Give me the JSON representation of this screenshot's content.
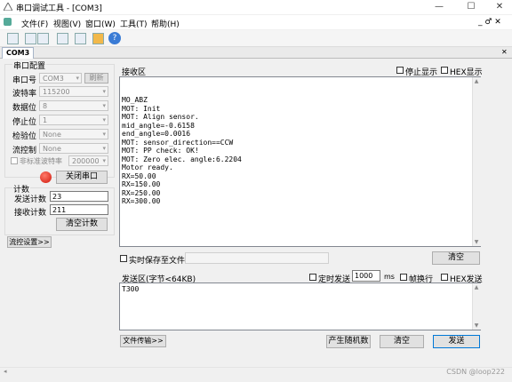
{
  "window": {
    "title": "串口调试工具 - [COM3]",
    "minimize": "—",
    "maximize": "☐",
    "close": "✕"
  },
  "menu": {
    "file": "文件(F)",
    "view": "视图(V)",
    "window": "窗口(W)",
    "tools": "工具(T)",
    "help": "帮助(H)",
    "right_controls": "_ ♂ ✕"
  },
  "tab": {
    "label": "COM3",
    "close": "✕"
  },
  "serial_config": {
    "title": "串口配置",
    "port_label": "串口号",
    "port_value": "COM3",
    "refresh_btn": "刷新",
    "baud_label": "波特率",
    "baud_value": "115200",
    "databits_label": "数据位",
    "databits_value": "8",
    "stopbits_label": "停止位",
    "stopbits_value": "1",
    "parity_label": "检验位",
    "parity_value": "None",
    "flow_label": "流控制",
    "flow_value": "None",
    "nonstd_label": "非标准波特率",
    "nonstd_value": "200000",
    "close_port_btn": "关闭串口"
  },
  "count": {
    "title": "计数",
    "send_label": "发送计数",
    "send_value": "23",
    "recv_label": "接收计数",
    "recv_value": "211",
    "clear_btn": "清空计数"
  },
  "flow_settings_btn": "流控设置>>",
  "receive": {
    "title": "接收区",
    "stop_display_label": "停止显示",
    "hex_display_label": "HEX显示",
    "lines": [
      "MO_ABZ",
      "MOT: Init",
      "MOT: Align sensor.",
      "mid_angle=-0.6158",
      "end_angle=0.0016",
      "MOT: sensor_direction==CCW",
      "MOT: PP check: OK!",
      "MOT: Zero elec. angle:6.2204",
      "Motor ready.",
      "RX=50.00",
      "RX=150.00",
      "RX=250.00",
      "RX=300.00"
    ],
    "save_file_label": "实时保存至文件",
    "clear_btn": "清空"
  },
  "send": {
    "title": "发送区(字节<64KB)",
    "timed_label": "定时发送",
    "interval_value": "1000",
    "ms_label": "ms",
    "newline_label": "帧换行",
    "hex_send_label": "HEX发送",
    "content": "T300",
    "file_transfer_btn": "文件传输>>",
    "random_btn": "产生随机数",
    "clear_btn": "清空",
    "send_btn": "发送"
  },
  "watermark": "CSDN @loop222"
}
